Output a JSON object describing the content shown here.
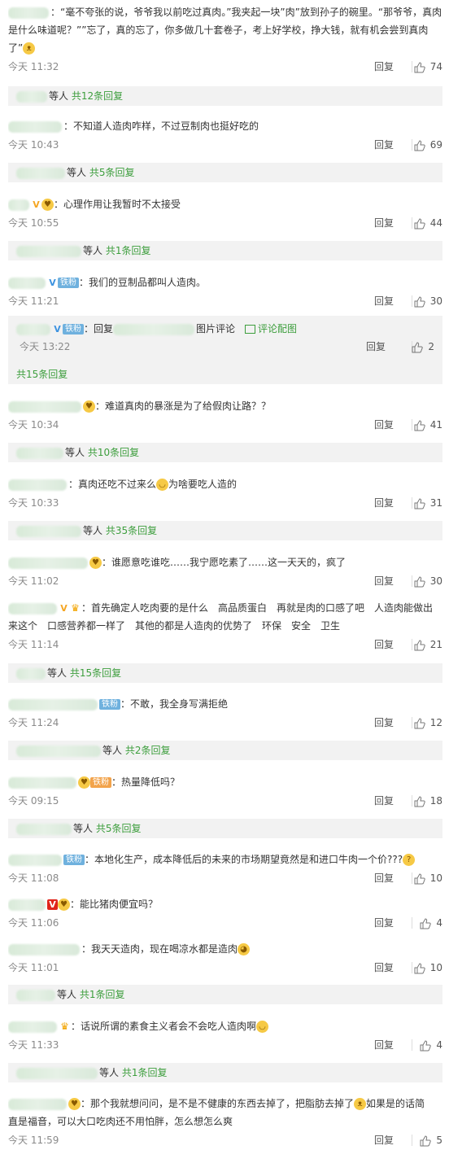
{
  "common": {
    "reply_label": "回复",
    "replies_suffix": "等人",
    "colon": "：",
    "fan_badge": "铁粉"
  },
  "comments": [
    {
      "lines": [
        "：“毫不夸张的说，爷爷我以前吃过真肉。”我夹起一块”肉”放到孙子的碗里。“那爷爷，真肉",
        "是什么味道呢？””忘了，真的忘了，你多做几十套卷子，考上好学校，挣大钱，就有机会尝到真肉",
        "了”"
      ],
      "time": "今天 11:32",
      "likes": "74",
      "thread": "共12条回复"
    },
    {
      "lines": [
        "：不知道人造肉咋样，不过豆制肉也挺好吃的"
      ],
      "time": "今天 10:43",
      "likes": "69",
      "thread": "共5条回复"
    },
    {
      "lines": [
        "：心理作用让我暂时不太接受"
      ],
      "time": "今天 10:55",
      "likes": "44",
      "thread": "共1条回复"
    },
    {
      "lines": [
        "：我们的豆制品都叫人造肉。"
      ],
      "time": "今天 11:21",
      "likes": "30"
    },
    {
      "lines": [
        "：难道真肉的暴涨是为了给假肉让路？？"
      ],
      "time": "今天 10:34",
      "likes": "41",
      "thread": "共10条回复"
    },
    {
      "lines": [
        "：真肉还吃不过来么",
        "为啥要吃人造的"
      ],
      "time": "今天 10:33",
      "likes": "31",
      "thread": "共35条回复"
    },
    {
      "lines": [
        "：谁愿意吃谁吃……我宁愿吃素了……这一天天的，疯了"
      ],
      "time": "今天 11:02",
      "likes": "30"
    },
    {
      "lines": [
        "：首先确定人吃肉要的是什么　高品质蛋白　再就是肉的口感了吧　人造肉能做出",
        "来这个　口感营养都一样了　其他的都是人造肉的优势了　环保　安全　卫生"
      ],
      "time": "今天 11:14",
      "likes": "21",
      "thread": "共15条回复"
    },
    {
      "lines": [
        "：不敢，我全身写满拒绝"
      ],
      "time": "今天 11:24",
      "likes": "12",
      "thread": "共2条回复"
    },
    {
      "lines": [
        "：热量降低吗？"
      ],
      "time": "今天 09:15",
      "likes": "18",
      "thread": "共5条回复"
    },
    {
      "lines": [
        "：本地化生产，成本降低后的未来的市场期望竟然是和进口牛肉一个价???"
      ],
      "time": "今天 11:08",
      "likes": "10"
    },
    {
      "lines": [
        "：能比猪肉便宜吗？"
      ],
      "time": "今天 11:06",
      "likes": "4"
    },
    {
      "lines": [
        "：我天天造肉，现在喝凉水都是造肉"
      ],
      "time": "今天 11:01",
      "likes": "10",
      "thread": "共1条回复"
    },
    {
      "lines": [
        "：话说所谓的素食主义者会不会吃人造肉啊"
      ],
      "time": "今天 11:33",
      "likes": "4",
      "thread": "共1条回复"
    },
    {
      "lines": [
        "：那个我就想问问，是不是不健康的东西去掉了，把脂肪去掉了",
        "如果是的话简",
        "直是福音，可以大口吃肉还不用怕胖，怎么想怎么爽"
      ],
      "time": "今天 11:59",
      "likes": "5"
    }
  ],
  "nested_reply": {
    "prefix": "：回复",
    "suffix": "图片评论",
    "link": "评论配图",
    "time": "今天 13:22",
    "likes": "2",
    "thread": "共15条回复"
  }
}
